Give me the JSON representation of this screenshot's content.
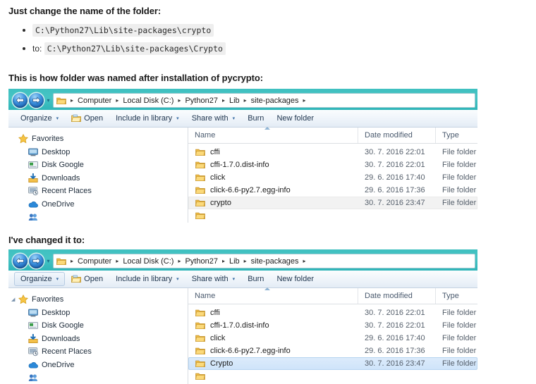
{
  "accent_frame_color": "#3fc0c0",
  "selection_color": "#cfe4fa",
  "prose": {
    "heading1": "Just change the name of the folder:",
    "bullet1_code": "C:\\Python27\\Lib\\site-packages\\crypto",
    "bullet2_prefix": "to:",
    "bullet2_code": "C:\\Python27\\Lib\\site-packages\\Crypto",
    "heading2": "This is how folder was named after installation of pycrypto:",
    "heading3": "I've changed it to:"
  },
  "explorer_common": {
    "back_icon": "back-arrow-icon",
    "forward_icon": "forward-arrow-icon",
    "history_caret": "▾",
    "address_folder_icon": "folder-icon",
    "breadcrumbs": [
      "Computer",
      "Local Disk (C:)",
      "Python27",
      "Lib",
      "site-packages"
    ],
    "breadcrumb_separator": "▸",
    "toolbar": [
      {
        "label": "Organize",
        "caret": "▾",
        "icon": null
      },
      {
        "label": "Open",
        "caret": "",
        "icon": "open-folder-icon"
      },
      {
        "label": "Include in library",
        "caret": "▾",
        "icon": null
      },
      {
        "label": "Share with",
        "caret": "▾",
        "icon": null
      },
      {
        "label": "Burn",
        "caret": "",
        "icon": null
      },
      {
        "label": "New folder",
        "caret": "",
        "icon": null
      }
    ],
    "nav_items": [
      {
        "label": "Favorites",
        "icon": "star-icon",
        "child": false
      },
      {
        "label": "Desktop",
        "icon": "desktop-icon",
        "child": true
      },
      {
        "label": "Disk Google",
        "icon": "drive-icon",
        "child": true
      },
      {
        "label": "Downloads",
        "icon": "downloads-icon",
        "child": true
      },
      {
        "label": "Recent Places",
        "icon": "recent-places-icon",
        "child": true
      },
      {
        "label": "OneDrive",
        "icon": "onedrive-cloud-icon",
        "child": true
      },
      {
        "label": "",
        "icon": "libraries-icon",
        "child": true
      }
    ],
    "columns": [
      "Name",
      "Date modified",
      "Type"
    ]
  },
  "window_before": {
    "organize_button_active": false,
    "favorites_expander": "",
    "files": [
      {
        "name": "cffi",
        "date": "30. 7. 2016 22:01",
        "type": "File folder",
        "state": ""
      },
      {
        "name": "cffi-1.7.0.dist-info",
        "date": "30. 7. 2016 22:01",
        "type": "File folder",
        "state": ""
      },
      {
        "name": "click",
        "date": "29. 6. 2016 17:40",
        "type": "File folder",
        "state": ""
      },
      {
        "name": "click-6.6-py2.7.egg-info",
        "date": "29. 6. 2016 17:36",
        "type": "File folder",
        "state": ""
      },
      {
        "name": "crypto",
        "date": "30. 7. 2016 23:47",
        "type": "File folder",
        "state": "hover"
      },
      {
        "name": "",
        "date": "",
        "type": "",
        "state": ""
      }
    ]
  },
  "window_after": {
    "organize_button_active": true,
    "favorites_expander": "◢",
    "files": [
      {
        "name": "cffi",
        "date": "30. 7. 2016 22:01",
        "type": "File folder",
        "state": ""
      },
      {
        "name": "cffi-1.7.0.dist-info",
        "date": "30. 7. 2016 22:01",
        "type": "File folder",
        "state": ""
      },
      {
        "name": "click",
        "date": "29. 6. 2016 17:40",
        "type": "File folder",
        "state": ""
      },
      {
        "name": "click-6.6-py2.7.egg-info",
        "date": "29. 6. 2016 17:36",
        "type": "File folder",
        "state": ""
      },
      {
        "name": "Crypto",
        "date": "30. 7. 2016 23:47",
        "type": "File folder",
        "state": "selected"
      },
      {
        "name": "",
        "date": "",
        "type": "",
        "state": ""
      }
    ]
  }
}
